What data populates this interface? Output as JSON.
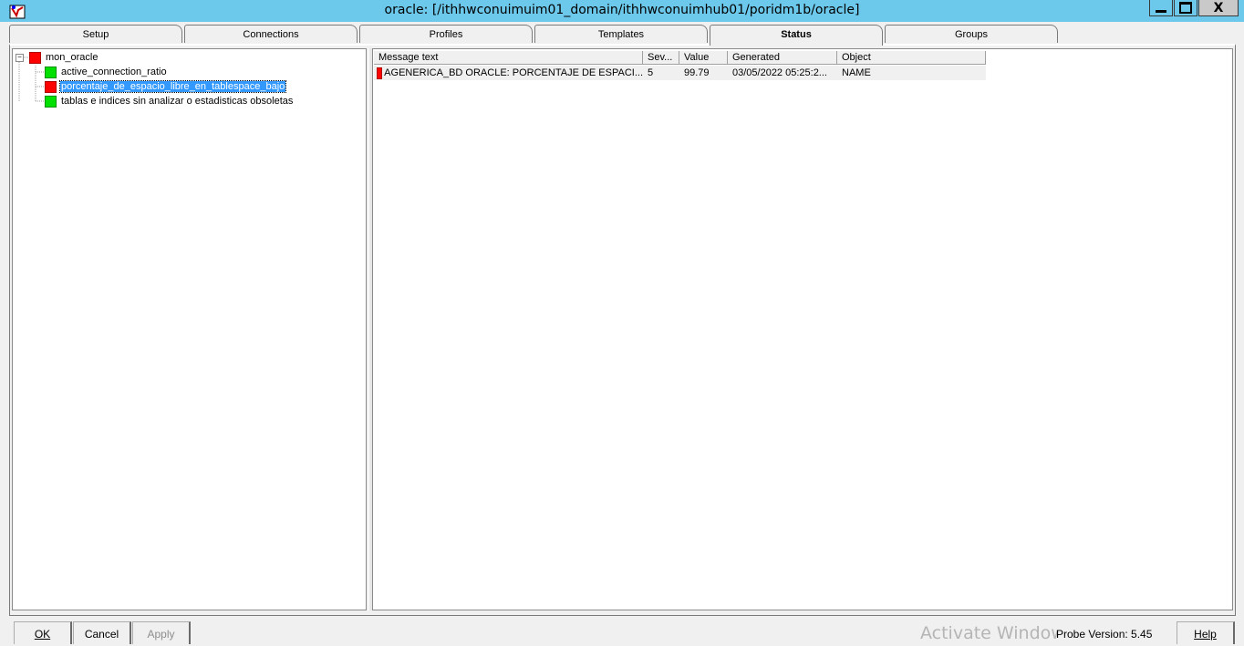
{
  "window": {
    "title": "oracle: [/ithhwconuimuim01_domain/ithhwconuimhub01/poridm1b/oracle]",
    "min_icon": "minimize-icon",
    "max_icon": "maximize-icon",
    "close_label": "X"
  },
  "tabs": [
    {
      "label": "Setup"
    },
    {
      "label": "Connections"
    },
    {
      "label": "Profiles"
    },
    {
      "label": "Templates"
    },
    {
      "label": "Status",
      "active": true
    },
    {
      "label": "Groups"
    }
  ],
  "tree": {
    "root": {
      "label": "mon_oracle",
      "status": "red",
      "expander": "−"
    },
    "children": [
      {
        "label": "active_connection_ratio",
        "status": "green"
      },
      {
        "label": "porcentaje_de_espacio_libre_en_tablespace_bajo",
        "status": "red",
        "selected": true
      },
      {
        "label": "tablas e indices sin analizar o estadisticas obsoletas",
        "status": "green"
      }
    ]
  },
  "list": {
    "columns": [
      "Message text",
      "Sev...",
      "Value",
      "Generated",
      "Object"
    ],
    "rows": [
      {
        "status": "red",
        "message": "AGENERICA_BD ORACLE: PORCENTAJE DE ESPACI...",
        "severity": "5",
        "value": "99.79",
        "generated": "03/05/2022 05:25:2...",
        "object": "NAME"
      }
    ]
  },
  "footer": {
    "ok_label": "OK",
    "cancel_label": "Cancel",
    "apply_label": "Apply",
    "help_label": "Help",
    "watermark": "Activate Windows",
    "probe_version": "Probe Version: 5.45"
  },
  "colors": {
    "titlebar": "#6cc9ec",
    "status_red": "#ff0000",
    "status_green": "#00e000",
    "selection": "#3399ff"
  }
}
